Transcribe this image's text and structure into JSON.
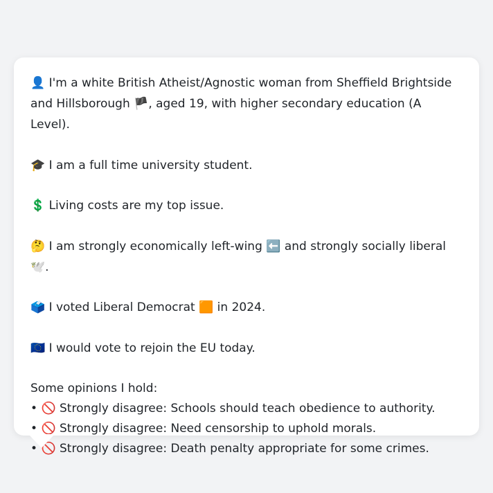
{
  "profile": {
    "identity": {
      "icon": "👤",
      "before_flag": "I'm a white British Atheist/Agnostic woman from Sheffield Brightside and Hillsborough ",
      "flag": "🏴",
      "after_flag": ", aged 19, with higher secondary education (A Level)."
    },
    "occupation": {
      "icon": "🎓",
      "text": "I am a full time university student."
    },
    "top_issue": {
      "icon": "💲",
      "text": "Living costs are my top issue."
    },
    "ideology": {
      "icon": "🤔",
      "before_left": "I am strongly economically left-wing ",
      "left_icon": "⬅️",
      "middle": " and strongly socially liberal ",
      "liberal_icon": "🕊️",
      "end": "."
    },
    "vote": {
      "icon": "🗳️",
      "before_party": "I voted Liberal Democrat ",
      "party_icon": "🟧",
      "after_party": " in 2024."
    },
    "eu": {
      "icon": "🇪🇺",
      "text": "I would vote to rejoin the EU today."
    }
  },
  "opinions": {
    "title": "Some opinions I hold:",
    "bullet": "•",
    "icon": "🚫",
    "items": [
      "Strongly disagree: Schools should teach obedience to authority.",
      "Strongly disagree: Need censorship to uphold morals.",
      "Strongly disagree: Death penalty appropriate for some crimes."
    ]
  }
}
